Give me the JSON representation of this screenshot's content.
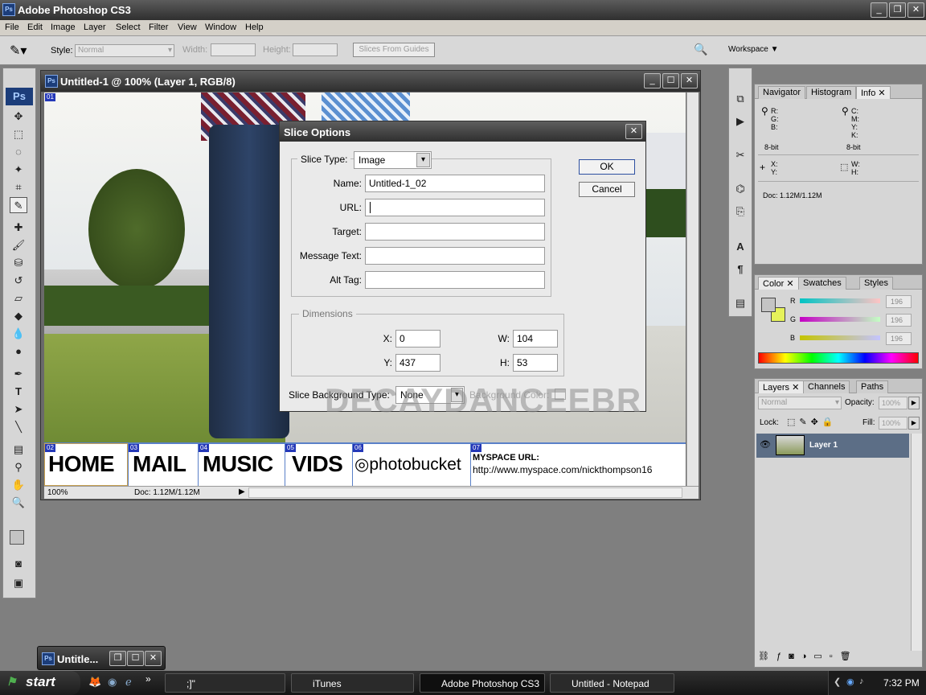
{
  "app": {
    "title": "Adobe Photoshop CS3"
  },
  "menu": [
    "File",
    "Edit",
    "Image",
    "Layer",
    "Select",
    "Filter",
    "View",
    "Window",
    "Help"
  ],
  "options": {
    "style_label": "Style:",
    "style_value": "Normal",
    "width_label": "Width:",
    "height_label": "Height:",
    "slices_button": "Slices From Guides",
    "workspace": "Workspace"
  },
  "document": {
    "title": "Untitled-1 @ 100% (Layer 1, RGB/8)",
    "zoom": "100%",
    "doc_size": "Doc: 1.12M/1.12M",
    "nav": {
      "home": "HOME",
      "mail": "MAIL",
      "music": "MUSIC",
      "vids": "VIDS",
      "photobucket": "photobucket",
      "myspace_label": "MYSPACE URL:",
      "myspace_url": "http://www.myspace.com/nickthompson16"
    },
    "slices": [
      "01",
      "02",
      "03",
      "04",
      "05",
      "06",
      "07"
    ],
    "watermark": "DECAYDANCEEBR"
  },
  "dialog": {
    "title": "Slice Options",
    "slice_type_label": "Slice Type:",
    "slice_type": "Image",
    "name_label": "Name:",
    "name_value": "Untitled-1_02",
    "url_label": "URL:",
    "url_value": "",
    "target_label": "Target:",
    "message_label": "Message Text:",
    "alt_label": "Alt Tag:",
    "dimensions_label": "Dimensions",
    "x_label": "X:",
    "x": "0",
    "y_label": "Y:",
    "y": "437",
    "w_label": "W:",
    "w": "104",
    "h_label": "H:",
    "h": "53",
    "bg_label": "Slice Background Type:",
    "bg_value": "None",
    "bg_color_label": "Background Color:",
    "ok": "OK",
    "cancel": "Cancel"
  },
  "info_panel": {
    "tabs": [
      "Navigator",
      "Histogram",
      "Info"
    ],
    "rgb": "R:\nG:\nB:",
    "cmyk": "C:\nM:\nY:\nK:",
    "bit_left": "8-bit",
    "bit_right": "8-bit",
    "xy": "X:\nY:",
    "wh": "W:\nH:",
    "doc": "Doc: 1.12M/1.12M"
  },
  "color_panel": {
    "tabs": [
      "Color",
      "Swatches",
      "Styles"
    ],
    "r_label": "R",
    "g_label": "G",
    "b_label": "B",
    "r": "196",
    "g": "196",
    "b": "196",
    "foreground": "#c4c4c4",
    "background": "#e6f25a"
  },
  "layers_panel": {
    "tabs": [
      "Layers",
      "Channels",
      "Paths"
    ],
    "blend": "Normal",
    "opacity_label": "Opacity:",
    "opacity": "100%",
    "lock_label": "Lock:",
    "fill_label": "Fill:",
    "fill": "100%",
    "layer_name": "Layer 1"
  },
  "minimized": {
    "title": "Untitle..."
  },
  "taskbar": {
    "start": "start",
    "items": [
      ";]\"",
      "iTunes",
      "Adobe Photoshop CS3",
      "Untitled - Notepad"
    ],
    "time": "7:32 PM"
  }
}
